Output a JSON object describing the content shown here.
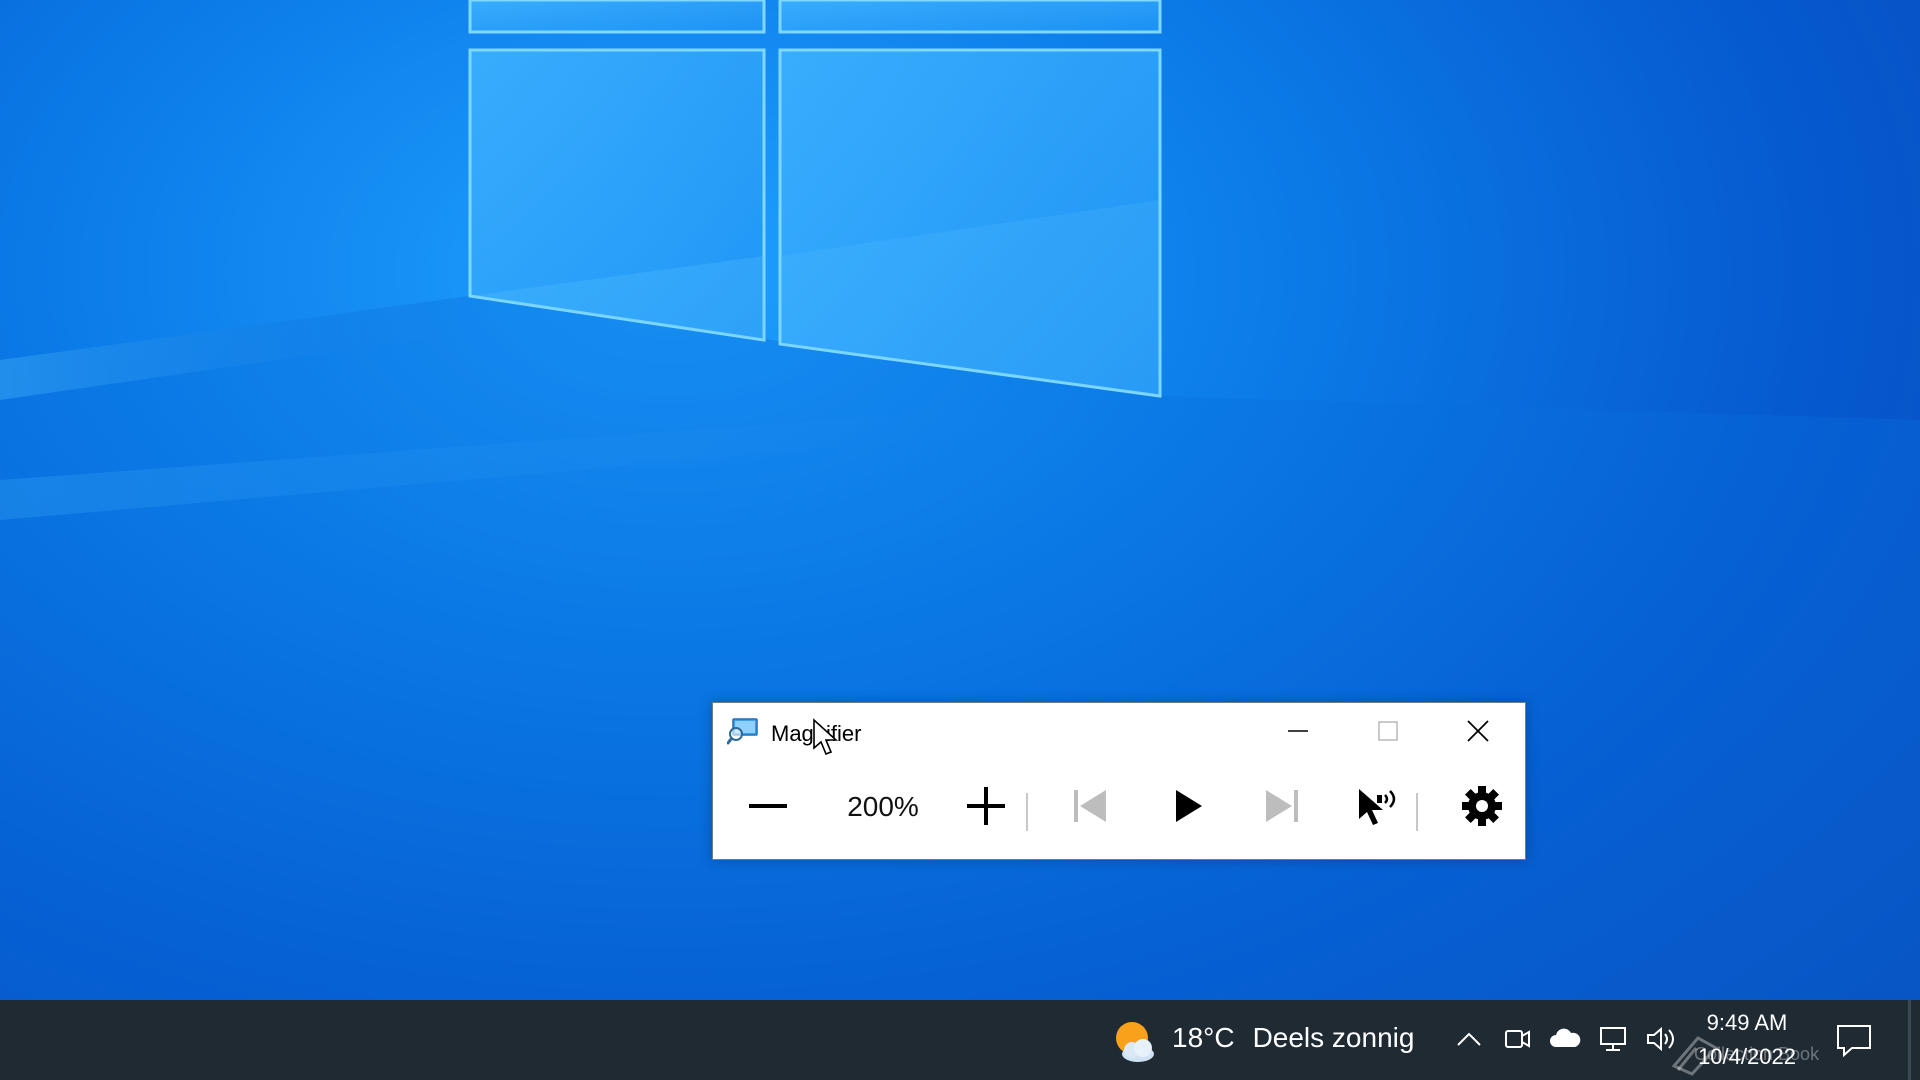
{
  "window": {
    "title": "Magnifier",
    "zoom_value": "200%"
  },
  "toolbar": {
    "buttons": [
      {
        "name": "zoom-out",
        "icon": "minus-icon"
      },
      {
        "name": "zoom-in",
        "icon": "plus-icon"
      },
      {
        "name": "read-previous",
        "icon": "skip-back-icon"
      },
      {
        "name": "read-play",
        "icon": "play-icon"
      },
      {
        "name": "read-next",
        "icon": "skip-forward-icon"
      },
      {
        "name": "read-from-here",
        "icon": "pointer-speaker-icon"
      },
      {
        "name": "settings",
        "icon": "gear-icon"
      }
    ]
  },
  "taskbar": {
    "weather": {
      "temperature": "18°C",
      "condition": "Deels zonnig"
    },
    "clock": {
      "time": "9:49 AM",
      "date": "10/4/2022"
    },
    "watermark": "Collection Book"
  },
  "colors": {
    "taskbar": "#1f2a33",
    "desktop_accent": "#0b7be8"
  }
}
